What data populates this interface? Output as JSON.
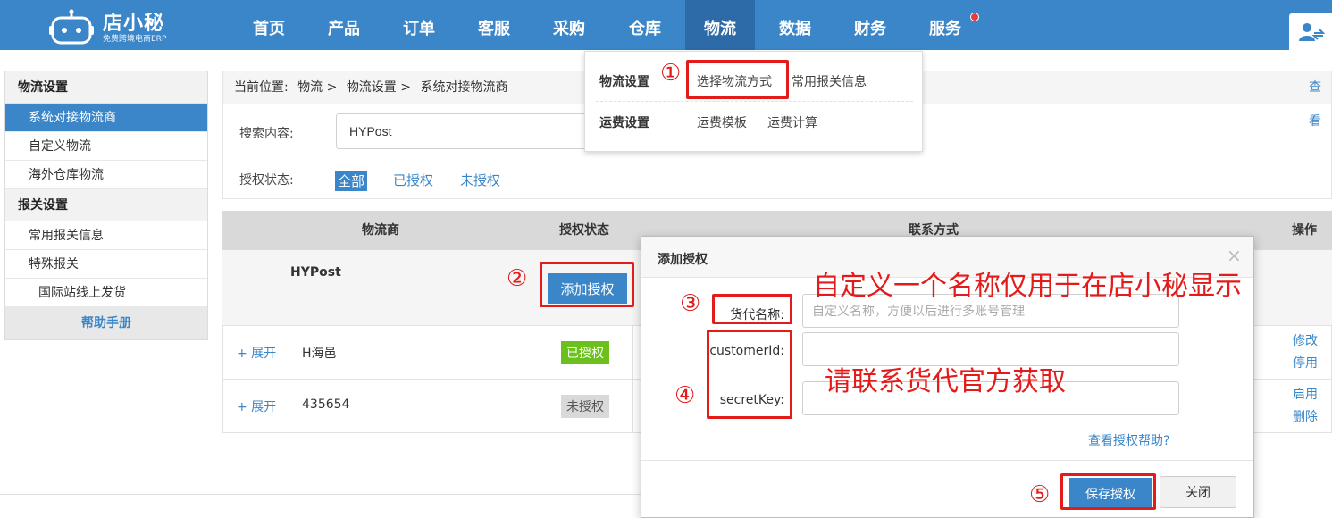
{
  "brand": {
    "name": "店小秘",
    "subtitle": "免费跨境电商ERP"
  },
  "nav": {
    "items": [
      "首页",
      "产品",
      "订单",
      "客服",
      "采购",
      "仓库",
      "物流",
      "数据",
      "财务",
      "服务"
    ],
    "active": "物流"
  },
  "sidebar": {
    "sections": [
      {
        "title": "物流设置",
        "items": [
          "系统对接物流商",
          "自定义物流",
          "海外仓库物流"
        ]
      },
      {
        "title": "报关设置",
        "items": [
          "常用报关信息",
          "特殊报关",
          "国际站线上发货"
        ]
      }
    ],
    "help": "帮助手册"
  },
  "breadcrumb": {
    "label": "当前位置:",
    "items": [
      "物流 >",
      "物流设置 >",
      "系统对接物流商"
    ],
    "right_link": "查看"
  },
  "filter": {
    "search_label": "搜索内容:",
    "search_value": "HYPost",
    "auth_label": "授权状态:",
    "tags": [
      "全部",
      "已授权",
      "未授权"
    ]
  },
  "table": {
    "headers": [
      "物流商",
      "授权状态",
      "联系方式",
      "操作"
    ],
    "group_name": "HYPost",
    "add_button": "添加授权",
    "rows": [
      {
        "expand": "+ 展开",
        "name": "H海邑",
        "status": "已授权",
        "ops": [
          "修改",
          "停用"
        ]
      },
      {
        "expand": "+ 展开",
        "name": "435654",
        "status": "未授权",
        "ops": [
          "启用",
          "删除"
        ]
      }
    ]
  },
  "dropdown": {
    "groups": [
      {
        "title": "物流设置",
        "links": [
          "选择物流方式",
          "常用报关信息"
        ]
      },
      {
        "title": "运费设置",
        "links": [
          "运费模板",
          "运费计算"
        ]
      }
    ]
  },
  "modal": {
    "title": "添加授权",
    "close": "×",
    "fields": [
      {
        "label": "货代名称:",
        "placeholder": "自定义名称，方便以后进行多账号管理",
        "value": ""
      },
      {
        "label": "customerId:",
        "placeholder": "",
        "value": ""
      },
      {
        "label": "secretKey:",
        "placeholder": "",
        "value": ""
      }
    ],
    "help_link": "查看授权帮助?",
    "save_button": "保存授权",
    "close_button": "关闭"
  },
  "annotations": {
    "numbers": [
      "①",
      "②",
      "③",
      "④",
      "⑤"
    ],
    "note_name": "自定义一个名称仅用于在店小秘显示",
    "note_keys": "请联系货代官方获取",
    "color": "#e31b1b"
  },
  "colors": {
    "primary": "#3a86c8",
    "authorized": "#6cc01c",
    "unauthorized": "#d9d9d9"
  }
}
